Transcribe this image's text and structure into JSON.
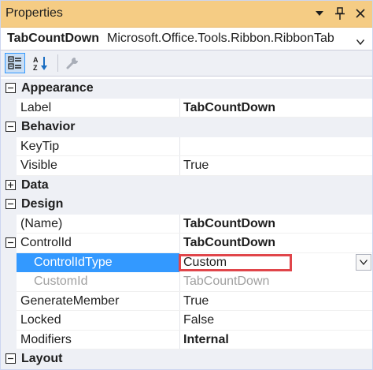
{
  "window": {
    "title": "Properties",
    "icons": [
      "chevron-down-icon",
      "pin-icon",
      "close-icon"
    ]
  },
  "object_selector": {
    "name": "TabCountDown",
    "type": "Microsoft.Office.Tools.Ribbon.RibbonTab"
  },
  "toolbar": {
    "buttons": [
      "categorized-icon",
      "alphabetical-icon",
      "property-pages-icon"
    ]
  },
  "grid": {
    "appearance": {
      "label": "Appearance",
      "expanded": true
    },
    "label": {
      "name": "Label",
      "value": "TabCountDown"
    },
    "behavior": {
      "label": "Behavior",
      "expanded": true
    },
    "keytip": {
      "name": "KeyTip",
      "value": ""
    },
    "visible": {
      "name": "Visible",
      "value": "True"
    },
    "data": {
      "label": "Data",
      "expanded": false
    },
    "design": {
      "label": "Design",
      "expanded": true
    },
    "name": {
      "name": "(Name)",
      "value": "TabCountDown"
    },
    "controlid": {
      "name": "ControlId",
      "value": "TabCountDown"
    },
    "controlidtype": {
      "name": "ControlIdType",
      "value": "Custom"
    },
    "customid": {
      "name": "CustomId",
      "value": "TabCountDown"
    },
    "generatemember": {
      "name": "GenerateMember",
      "value": "True"
    },
    "locked": {
      "name": "Locked",
      "value": "False"
    },
    "modifiers": {
      "name": "Modifiers",
      "value": "Internal"
    },
    "layout": {
      "label": "Layout",
      "expanded": true
    }
  },
  "colors": {
    "titlebar": "#f5cc84",
    "selection": "#3399ff",
    "highlight_box": "#e0454a",
    "category_bg": "#eef0f5"
  }
}
